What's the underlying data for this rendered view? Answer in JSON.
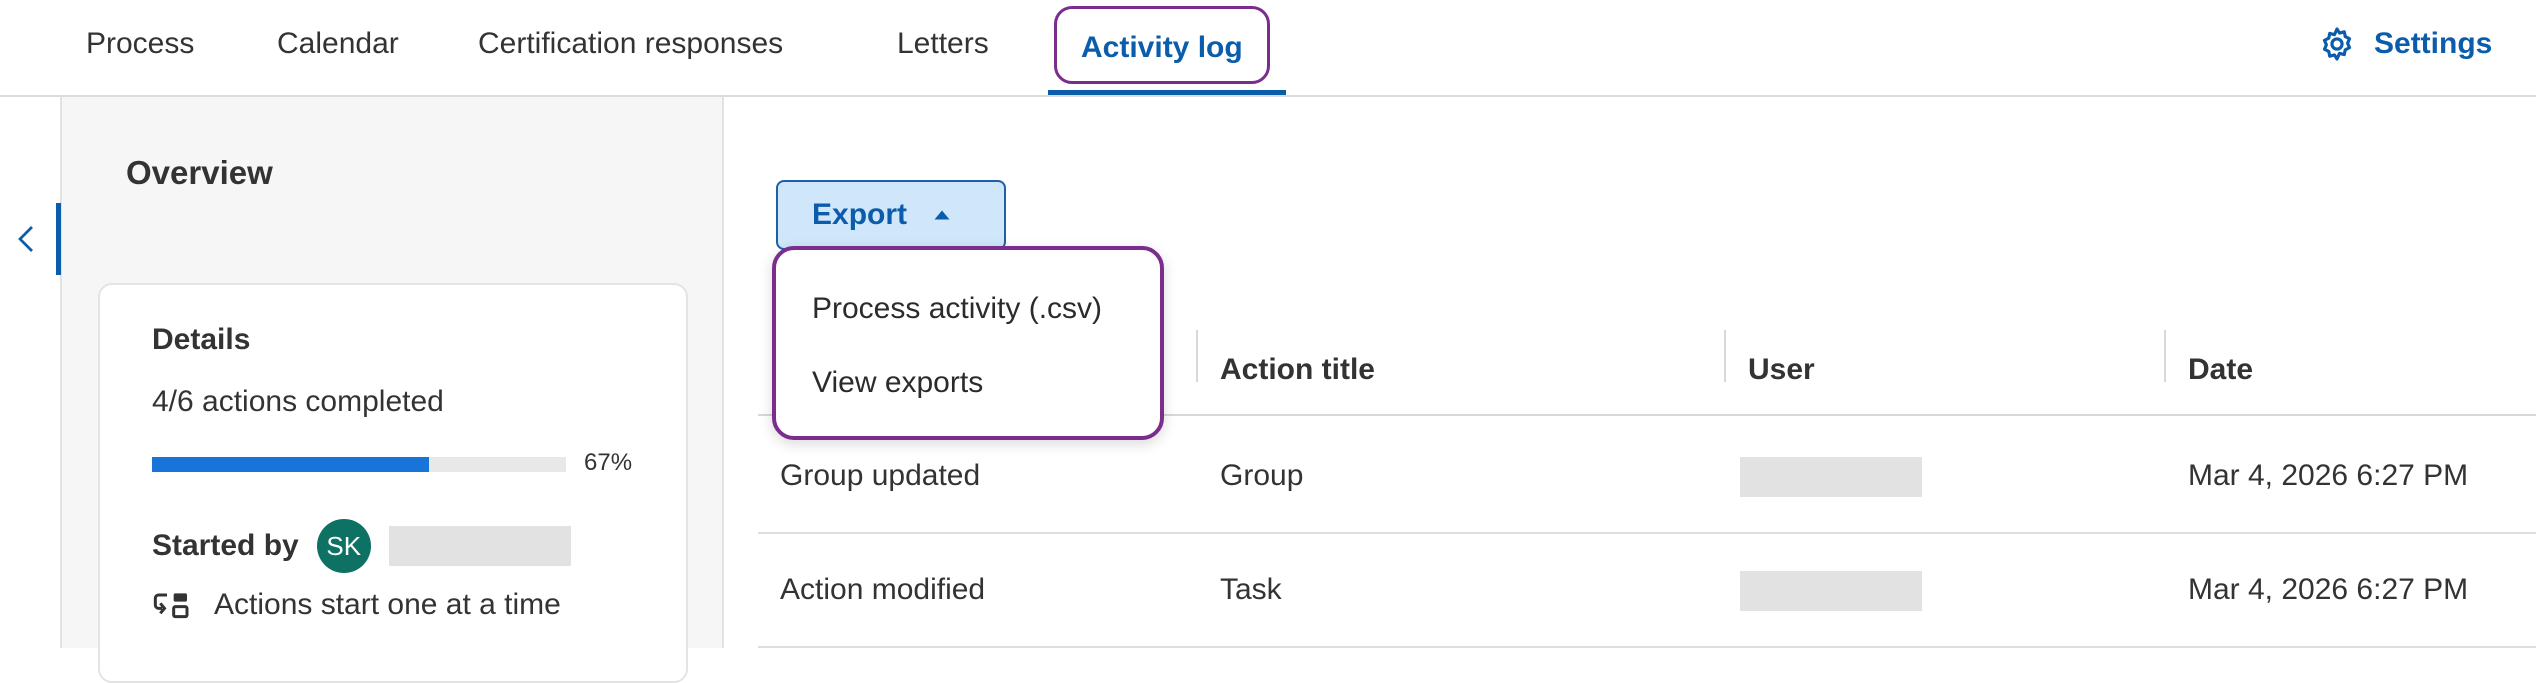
{
  "tabs": {
    "process": "Process",
    "calendar": "Calendar",
    "certification": "Certification responses",
    "letters": "Letters",
    "activity_log": "Activity log"
  },
  "settings": {
    "label": "Settings",
    "icon": "gear-icon"
  },
  "sidebar": {
    "collapse_icon": "chevron-left-icon"
  },
  "overview": {
    "title": "Overview",
    "details": {
      "heading": "Details",
      "actions_completed": "4/6 actions completed",
      "progress_fraction": 0.67,
      "progress_label": "67%",
      "started_by_label": "Started by",
      "avatar_initials": "SK",
      "sequence_text": "Actions start one at a time",
      "sequence_icon": "sequential-actions-icon"
    }
  },
  "export": {
    "label": "Export",
    "icon": "caret-up-icon",
    "menu": [
      "Process activity (.csv)",
      "View exports"
    ]
  },
  "table": {
    "columns": [
      "Action title",
      "User",
      "Date"
    ],
    "rows": [
      {
        "activity": "Group updated",
        "action_title": "Group",
        "date": "Mar 4, 2026 6:27 PM"
      },
      {
        "activity": "Action modified",
        "action_title": "Task",
        "date": "Mar 4, 2026 6:27 PM"
      }
    ]
  },
  "colors": {
    "accent": "#0b5cab",
    "highlight_outline": "#7b2d8e",
    "progress": "#1874d8",
    "avatar_bg": "#0d7263",
    "export_bg": "#cfe6fb"
  }
}
